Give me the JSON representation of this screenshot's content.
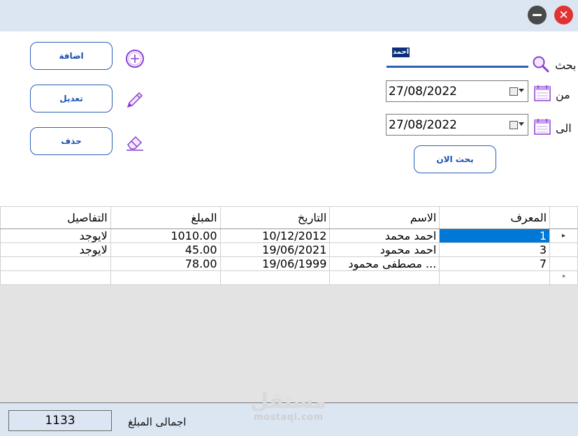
{
  "titlebar": {
    "minimize_icon": "minimize-icon",
    "close_icon": "close-icon",
    "close_glyph": "✕"
  },
  "actions": {
    "add_label": "اضافة",
    "edit_label": "تعديل",
    "delete_label": "حذف",
    "add_icon": "plus-circle-icon",
    "edit_icon": "pencil-icon",
    "delete_icon": "eraser-icon"
  },
  "search": {
    "label": "بحث",
    "value": "احمد",
    "icon": "search-icon",
    "from_label": "من",
    "from_date": "27/08/2022",
    "to_label": "الى",
    "to_date": "27/08/2022",
    "calendar_icon": "calendar-icon",
    "search_now_label": "بحث الان"
  },
  "table": {
    "columns": [
      "المعرف",
      "الاسم",
      "التاريخ",
      "المبلغ",
      "التفاصيل"
    ],
    "rows": [
      {
        "id": "1",
        "name": "احمد محمد",
        "date": "10/12/2012",
        "amount": "1010.00",
        "details": "لايوجد"
      },
      {
        "id": "3",
        "name": "احمد محمود",
        "date": "19/06/2021",
        "amount": "45.00",
        "details": "لايوجد"
      },
      {
        "id": "7",
        "name": "مصطفى محمود ...",
        "date": "19/06/1999",
        "amount": "78.00",
        "details": ""
      }
    ],
    "current_row_marker": "▸",
    "new_row_marker": "*"
  },
  "footer": {
    "total_label": "اجمالى المبلغ",
    "total_value": "1133"
  },
  "watermark": {
    "text": "مستقل",
    "subtext": "mostaql.com"
  },
  "colors": {
    "accent": "#2b5fb8",
    "titlebar": "#dce6f2",
    "selection": "#0078d7",
    "close": "#e03232",
    "icon_purple": "#8a3fd1"
  }
}
